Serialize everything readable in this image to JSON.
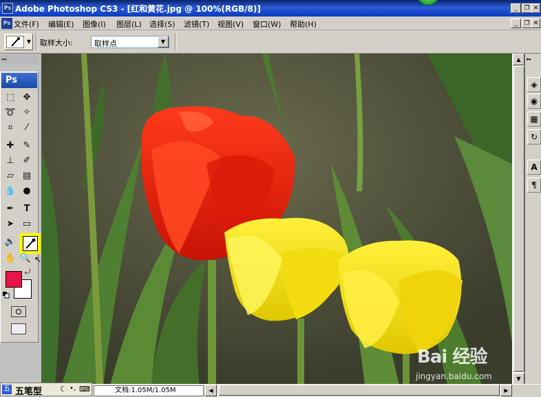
{
  "window": {
    "title": "Adobe Photoshop CS3 - [红和黄花.jpg @ 100%(RGB/8)]",
    "app_icon_text": "Ps"
  },
  "menu": {
    "items": [
      "文件(F)",
      "编辑(E)",
      "图像(I)",
      "图层(L)",
      "选择(S)",
      "滤镜(T)",
      "视图(V)",
      "窗口(W)",
      "帮助(H)"
    ]
  },
  "options": {
    "sample_size_label": "取样大小:",
    "sample_size_value": "取样点"
  },
  "toolbox": {
    "logo": "Ps",
    "foreground_color": "#e8144a",
    "background_color": "#ffffff",
    "active_tool": "eyedropper-icon"
  },
  "status": {
    "ime_label": "五笔型",
    "doc_size": "文档:1.05M/1.05M"
  },
  "watermark": {
    "logo": "Bai 经验",
    "url": "jingyan.baidu.com"
  },
  "colors": {
    "title_bar": "#0a246a",
    "highlight": "#ffff00",
    "tulip_red": "#e8200a",
    "tulip_yellow": "#f5e011"
  }
}
